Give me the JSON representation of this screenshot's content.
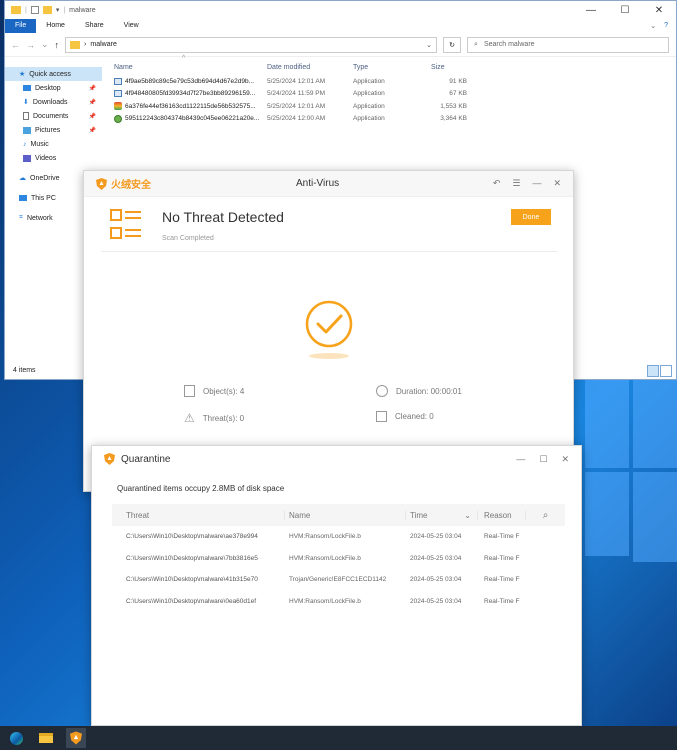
{
  "explorer": {
    "title": "malware",
    "ribbon_tabs": [
      "File",
      "Home",
      "Share",
      "View"
    ],
    "address": "malware",
    "search_placeholder": "Search malware",
    "nav": [
      {
        "label": "Quick access",
        "icon": "star-icon",
        "active": true,
        "pinned": false
      },
      {
        "label": "Desktop",
        "icon": "desktop-folder-icon",
        "pinned": true
      },
      {
        "label": "Downloads",
        "icon": "download-icon",
        "pinned": true
      },
      {
        "label": "Documents",
        "icon": "documents-icon",
        "pinned": true
      },
      {
        "label": "Pictures",
        "icon": "pictures-icon",
        "pinned": true
      },
      {
        "label": "Music",
        "icon": "music-icon",
        "pinned": false
      },
      {
        "label": "Videos",
        "icon": "videos-icon",
        "pinned": false
      },
      {
        "label": "OneDrive",
        "icon": "cloud-icon",
        "pinned": false
      },
      {
        "label": "This PC",
        "icon": "computer-icon",
        "pinned": false
      },
      {
        "label": "Network",
        "icon": "network-icon",
        "pinned": false
      }
    ],
    "columns": [
      "Name",
      "Date modified",
      "Type",
      "Size"
    ],
    "files": [
      {
        "name": "4f9ae5b89c89c5e79c53db694d4d67e2d9b...",
        "date": "5/25/2024 12:01 AM",
        "type": "Application",
        "size": "91 KB",
        "icon": "app-icon"
      },
      {
        "name": "4f948480805fd39934d7f27be3bb89296159...",
        "date": "5/24/2024 11:59 PM",
        "type": "Application",
        "size": "67 KB",
        "icon": "app-icon"
      },
      {
        "name": "6a376fe44ef36163cd1122115de56b532575...",
        "date": "5/25/2024 12:01 AM",
        "type": "Application",
        "size": "1,553 KB",
        "icon": "app-colored-icon"
      },
      {
        "name": "595112243c804374b8439c045ee06221a20e...",
        "date": "5/25/2024 12:00 AM",
        "type": "Application",
        "size": "3,364 KB",
        "icon": "app-globe-icon"
      }
    ],
    "status": "4 items"
  },
  "antivirus": {
    "brand": "火绒安全",
    "title": "Anti-Virus",
    "heading": "No Threat Detected",
    "subheading": "Scan Completed",
    "done_label": "Done",
    "stats": {
      "objects": "Object(s): 4",
      "threats": "Threat(s): 0",
      "duration": "Duration: 00:00:01",
      "cleaned": "Cleaned: 0"
    },
    "accent": "#f7a21b"
  },
  "quarantine": {
    "title": "Quarantine",
    "message": "Quarantined items occupy 2.8MB of disk space",
    "columns": [
      "Threat",
      "Name",
      "Time",
      "Reason"
    ],
    "rows": [
      {
        "threat": "C:\\Users\\Win10\\Desktop\\malware\\ae378e994",
        "name": "HVM:Ransom/LockFile.b",
        "time": "2024-05-25 03:04",
        "reason": "Real-Time F"
      },
      {
        "threat": "C:\\Users\\Win10\\Desktop\\malware\\7bb3816e5",
        "name": "HVM:Ransom/LockFile.b",
        "time": "2024-05-25 03:04",
        "reason": "Real-Time F"
      },
      {
        "threat": "C:\\Users\\Win10\\Desktop\\malware\\41b315e70",
        "name": "Trojan/Generic!E8FCC1ECD1142",
        "time": "2024-05-25 03:04",
        "reason": "Real-Time F"
      },
      {
        "threat": "C:\\Users\\Win10\\Desktop\\malware\\0ea60d1ef",
        "name": "HVM:Ransom/LockFile.b",
        "time": "2024-05-25 03:04",
        "reason": "Real-Time F"
      }
    ]
  }
}
